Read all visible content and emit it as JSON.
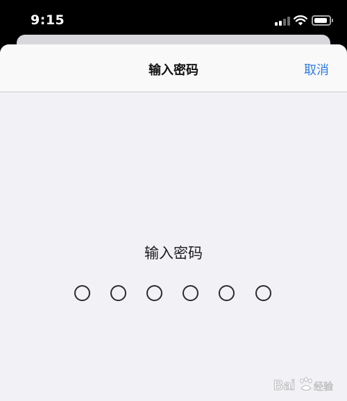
{
  "status_bar": {
    "time": "9:15",
    "signal_icon": "cellular-signal-icon",
    "wifi_icon": "wifi-icon",
    "battery_icon": "battery-icon"
  },
  "sheet": {
    "title": "输入密码",
    "cancel_label": "取消",
    "accent_color": "#2c7be5"
  },
  "passcode": {
    "prompt": "输入密码",
    "digit_count": 6,
    "entered_count": 0
  },
  "watermark": {
    "text": "Bai 经验"
  }
}
